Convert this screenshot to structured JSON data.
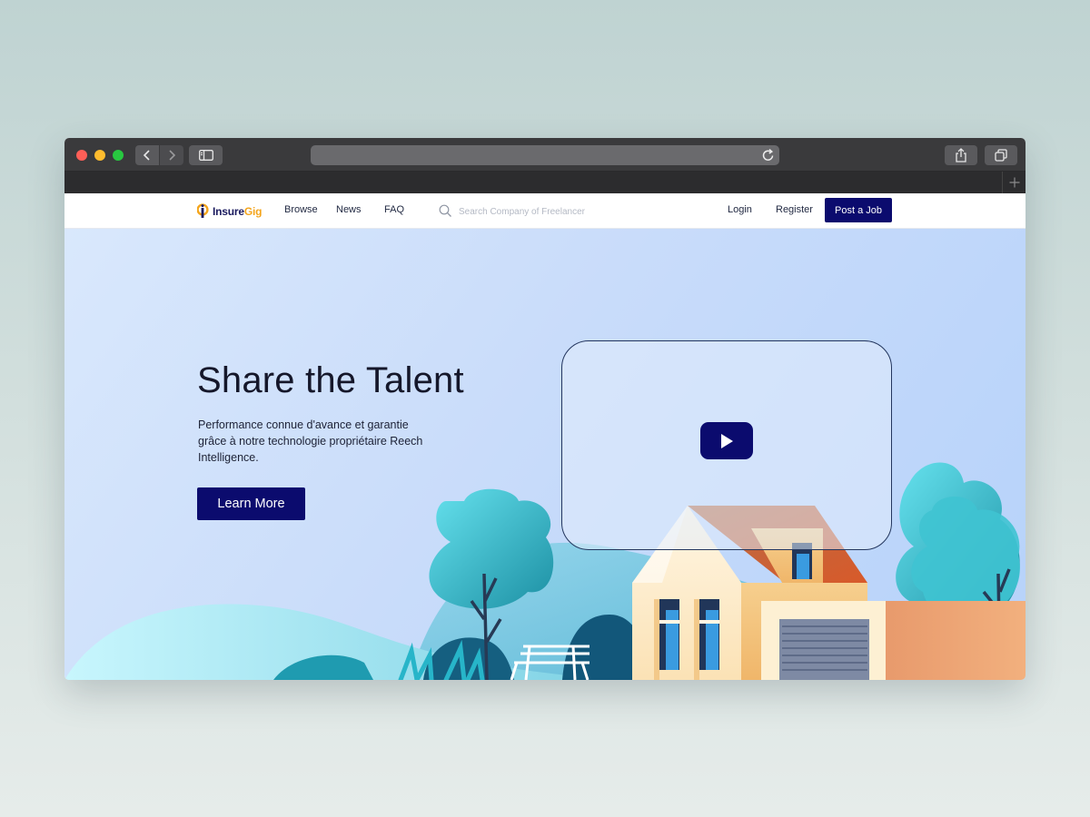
{
  "browser": {
    "url": "",
    "icons": [
      "back-arrow-icon",
      "forward-arrow-icon",
      "sidebar-icon",
      "reload-icon",
      "share-icon",
      "tabs-icon",
      "new-tab-plus-icon"
    ]
  },
  "header": {
    "logo": {
      "prefix": "Insure",
      "suffix": "Gig"
    },
    "nav": [
      "Browse",
      "News",
      "FAQ"
    ],
    "search": {
      "placeholder": "Search Company of Freelancer",
      "value": ""
    },
    "login": "Login",
    "register": "Register",
    "post_job": "Post a Job"
  },
  "hero": {
    "title": "Share the Talent",
    "description": "Performance connue d'avance et garantie grâce à notre technologie propriétaire Reech Intelligence.",
    "cta": "Learn More"
  },
  "colors": {
    "brand_navy": "#0b0b6e",
    "logo_accent": "#f4a51c",
    "hero_bg_start": "#d9e8fc",
    "hero_bg_end": "#b6d2fa"
  }
}
